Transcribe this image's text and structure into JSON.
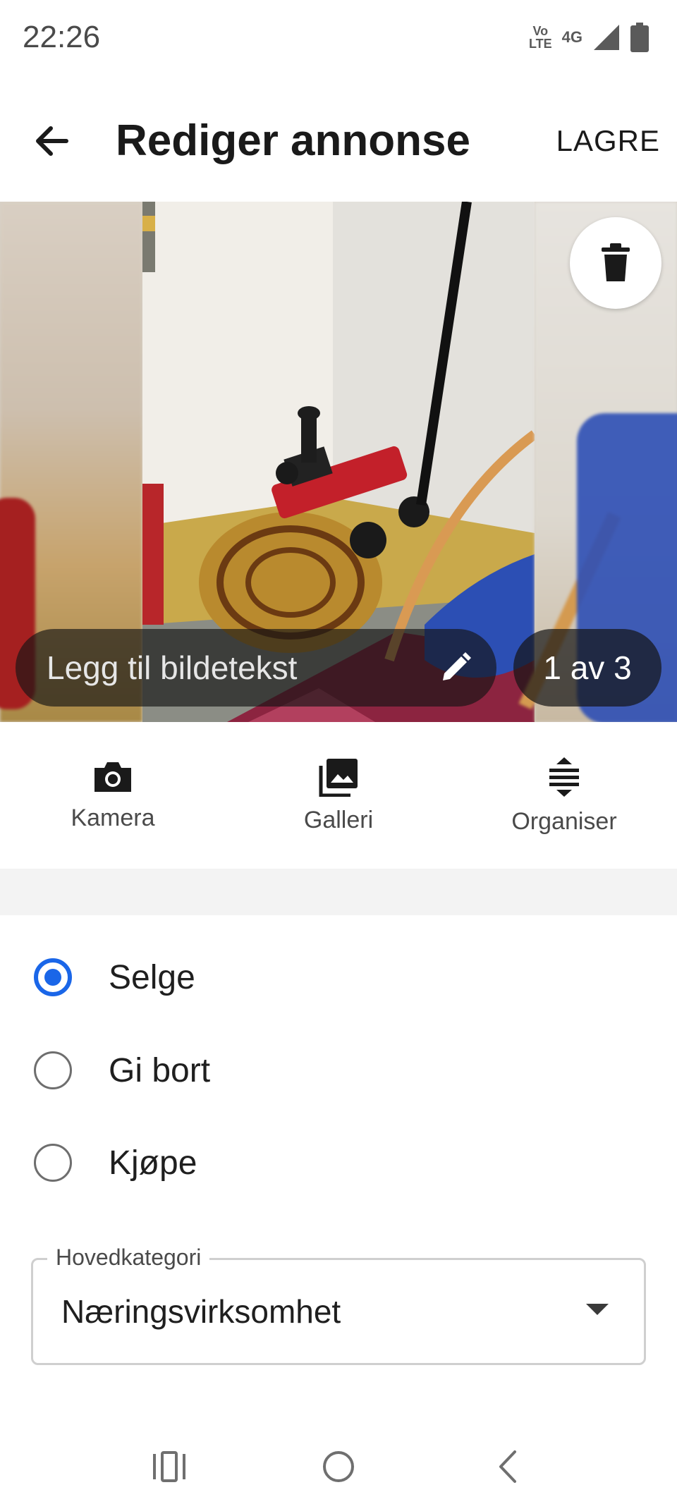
{
  "status_bar": {
    "time": "22:26",
    "volte_top": "Vo",
    "volte_bottom": "LTE",
    "network": "4G",
    "icons": [
      "volte-icon",
      "signal-icon",
      "battery-icon"
    ]
  },
  "app_bar": {
    "title": "Rediger annonse",
    "save_label": "LAGRE",
    "back_icon": "arrow-left-icon"
  },
  "gallery": {
    "caption_placeholder": "Legg til bildetekst",
    "counter": "1 av 3",
    "delete_icon": "trash-icon",
    "edit_icon": "pencil-icon"
  },
  "image_actions": [
    {
      "label": "Kamera",
      "icon": "camera-icon"
    },
    {
      "label": "Galleri",
      "icon": "gallery-icon"
    },
    {
      "label": "Organiser",
      "icon": "reorder-icon"
    }
  ],
  "ad_type": {
    "options": [
      {
        "label": "Selge",
        "selected": true
      },
      {
        "label": "Gi bort",
        "selected": false
      },
      {
        "label": "Kjøpe",
        "selected": false
      }
    ]
  },
  "category": {
    "label": "Hovedkategori",
    "value": "Næringsvirksomhet"
  },
  "colors": {
    "accent": "#1a66e8",
    "text": "#1f1f1f",
    "secondary_text": "#4a4a4a"
  }
}
